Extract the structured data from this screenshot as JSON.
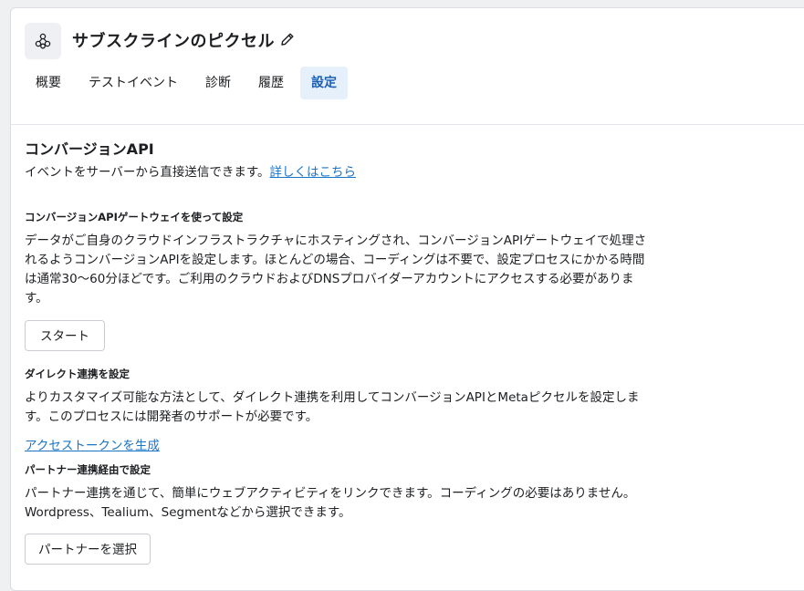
{
  "header": {
    "title": "サブスクラインのピクセル",
    "tabs": [
      {
        "label": "概要"
      },
      {
        "label": "テストイベント"
      },
      {
        "label": "診断"
      },
      {
        "label": "履歴"
      },
      {
        "label": "設定",
        "active": true
      }
    ],
    "icons": {
      "app": "pixel-network-icon",
      "edit": "pencil-icon"
    }
  },
  "conversions_api": {
    "title": "コンバージョンAPI",
    "intro": "イベントをサーバーから直接送信できます。",
    "learn_more": "詳しくはこちら"
  },
  "gateway": {
    "title": "コンバージョンAPIゲートウェイを使って設定",
    "body": [
      "データがご自身のクラウドインフラストラクチャにホスティングされ、コンバージョンAPIゲートウェイで処理さ",
      "れるようコンバージョンAPIを設定します。ほとんどの場合、コーディングは不要で、設定プロセスにかかる時間",
      "は通常30〜60分ほどです。ご利用のクラウドおよびDNSプロバイダーアカウントにアクセスする必要がありま",
      "す。"
    ],
    "button": "スタート"
  },
  "direct": {
    "title": "ダイレクト連携を設定",
    "body": [
      "よりカスタマイズ可能な方法として、ダイレクト連携を利用してコンバージョンAPIとMetaピクセルを設定しま",
      "す。このプロセスには開発者のサポートが必要です。"
    ],
    "link": "アクセストークンを生成"
  },
  "partner": {
    "title": "パートナー連携経由で設定",
    "body": [
      "パートナー連携を通じて、簡単にウェブアクティビティをリンクできます。コーディングの必要はありません。",
      "Wordpress、Tealium、Segmentなどから選択できます。"
    ],
    "button": "パートナーを選択"
  },
  "colors": {
    "accent": "#1b74c5",
    "active_tab_bg": "#e6f0fb",
    "active_tab_text": "#1b5fb5"
  }
}
